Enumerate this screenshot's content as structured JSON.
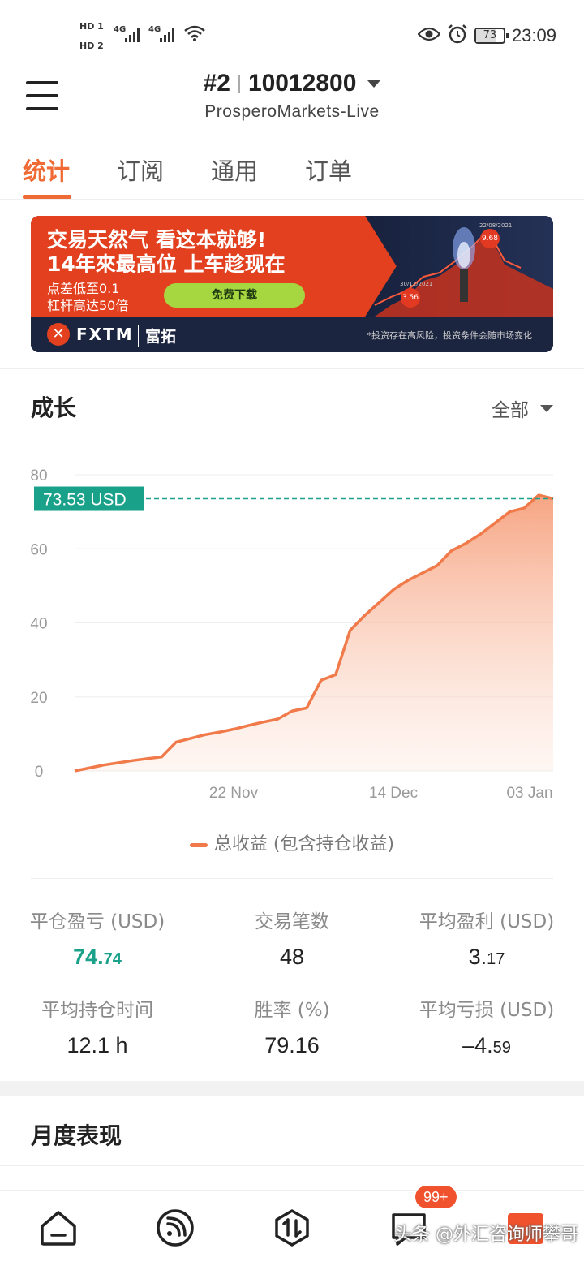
{
  "status_bar": {
    "hd1": "HD 1",
    "hd2": "HD 2",
    "net1": "4G",
    "net2": "4G",
    "battery_level": 73,
    "battery_label": "73",
    "time": "23:09",
    "icons": [
      "eye-icon",
      "alarm-icon",
      "battery-icon",
      "wifi-icon",
      "signal-icon"
    ]
  },
  "header": {
    "account_index": "#2",
    "account_number": "10012800",
    "server": "ProsperoMarkets-Live"
  },
  "tabs": [
    {
      "label": "统计",
      "active": true
    },
    {
      "label": "订阅",
      "active": false
    },
    {
      "label": "通用",
      "active": false
    },
    {
      "label": "订单",
      "active": false
    }
  ],
  "banner": {
    "line1": "交易天然气 看这本就够!",
    "line2": "14年來最高位 上车趁现在",
    "small1": "点差低至0.1",
    "small2": "杠杆高达50倍",
    "button": "免费下载",
    "brand": "FXTM",
    "brand_cn": "富拓",
    "risk": "*投资存在高风险，投资条件会随市场变化",
    "bubble1_value": "3.56",
    "bubble1_date": "30/12/2021",
    "bubble2_value": "9.68",
    "bubble2_date": "22/08/2021"
  },
  "growth": {
    "title": "成长",
    "range_label": "全部"
  },
  "chart_data": {
    "type": "area",
    "title": "",
    "xlabel": "",
    "ylabel": "",
    "ylim": [
      0,
      80
    ],
    "yticks": [
      0,
      20,
      40,
      60,
      80
    ],
    "xticks": [
      "22 Nov",
      "14 Dec",
      "03 Jan"
    ],
    "current_value_label": "73.53 USD",
    "current_value": 73.53,
    "grid": "horizontal",
    "legend_position": "bottom",
    "series": [
      {
        "name": "总收益 (包含持仓收益)",
        "color": "#f07a4a",
        "values": [
          0,
          0.8,
          1.6,
          2.2,
          2.8,
          3.3,
          3.8,
          7.8,
          8.8,
          9.8,
          10.5,
          11.3,
          12.3,
          13.2,
          14.0,
          16.2,
          17.0,
          24.5,
          26.0,
          38.0,
          42.0,
          45.5,
          49.0,
          51.5,
          53.5,
          55.5,
          59.5,
          61.5,
          64.0,
          67.0,
          70.0,
          71.0,
          74.5,
          73.53
        ]
      }
    ]
  },
  "stats": [
    {
      "label": "平仓盈亏 (USD)",
      "int": "74.",
      "dec": "74",
      "positive": true
    },
    {
      "label": "交易笔数",
      "int": "48",
      "dec": "",
      "positive": false
    },
    {
      "label": "平均盈利 (USD)",
      "int": "3.",
      "dec": "17",
      "positive": false
    },
    {
      "label": "平均持仓时间",
      "int": "12.1 h",
      "dec": "",
      "positive": false
    },
    {
      "label": "胜率 (%)",
      "int": "79.16",
      "dec": "",
      "positive": false
    },
    {
      "label": "平均亏损 (USD)",
      "int": "–4.",
      "dec": "59",
      "positive": false
    }
  ],
  "monthly": {
    "title": "月度表现"
  },
  "bottom_nav": {
    "badge": "99+",
    "watermark": "头条 @外汇咨询师攀哥",
    "items": [
      "home-icon",
      "feed-icon",
      "trade-icon",
      "message-icon",
      "profile-icon"
    ]
  },
  "colors": {
    "accent": "#f06a35",
    "positive": "#1aa189",
    "line": "#f07a4a"
  }
}
